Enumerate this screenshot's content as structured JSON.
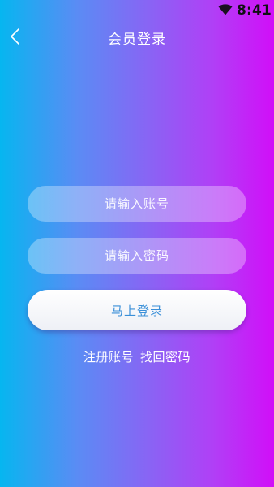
{
  "status_bar": {
    "time": "8:41",
    "icons": [
      "wifi-icon"
    ]
  },
  "header": {
    "title": "会员登录",
    "back_icon": "chevron-left-icon"
  },
  "form": {
    "account_placeholder": "请输入账号",
    "password_placeholder": "请输入密码",
    "login_label": "马上登录"
  },
  "links": {
    "register_label": "注册账号",
    "forgot_label": "找回密码"
  },
  "colors": {
    "gradient_start": "#06b6f0",
    "gradient_end": "#d10ef8",
    "button_text": "#3a8fd8",
    "status_text": "#101014"
  }
}
